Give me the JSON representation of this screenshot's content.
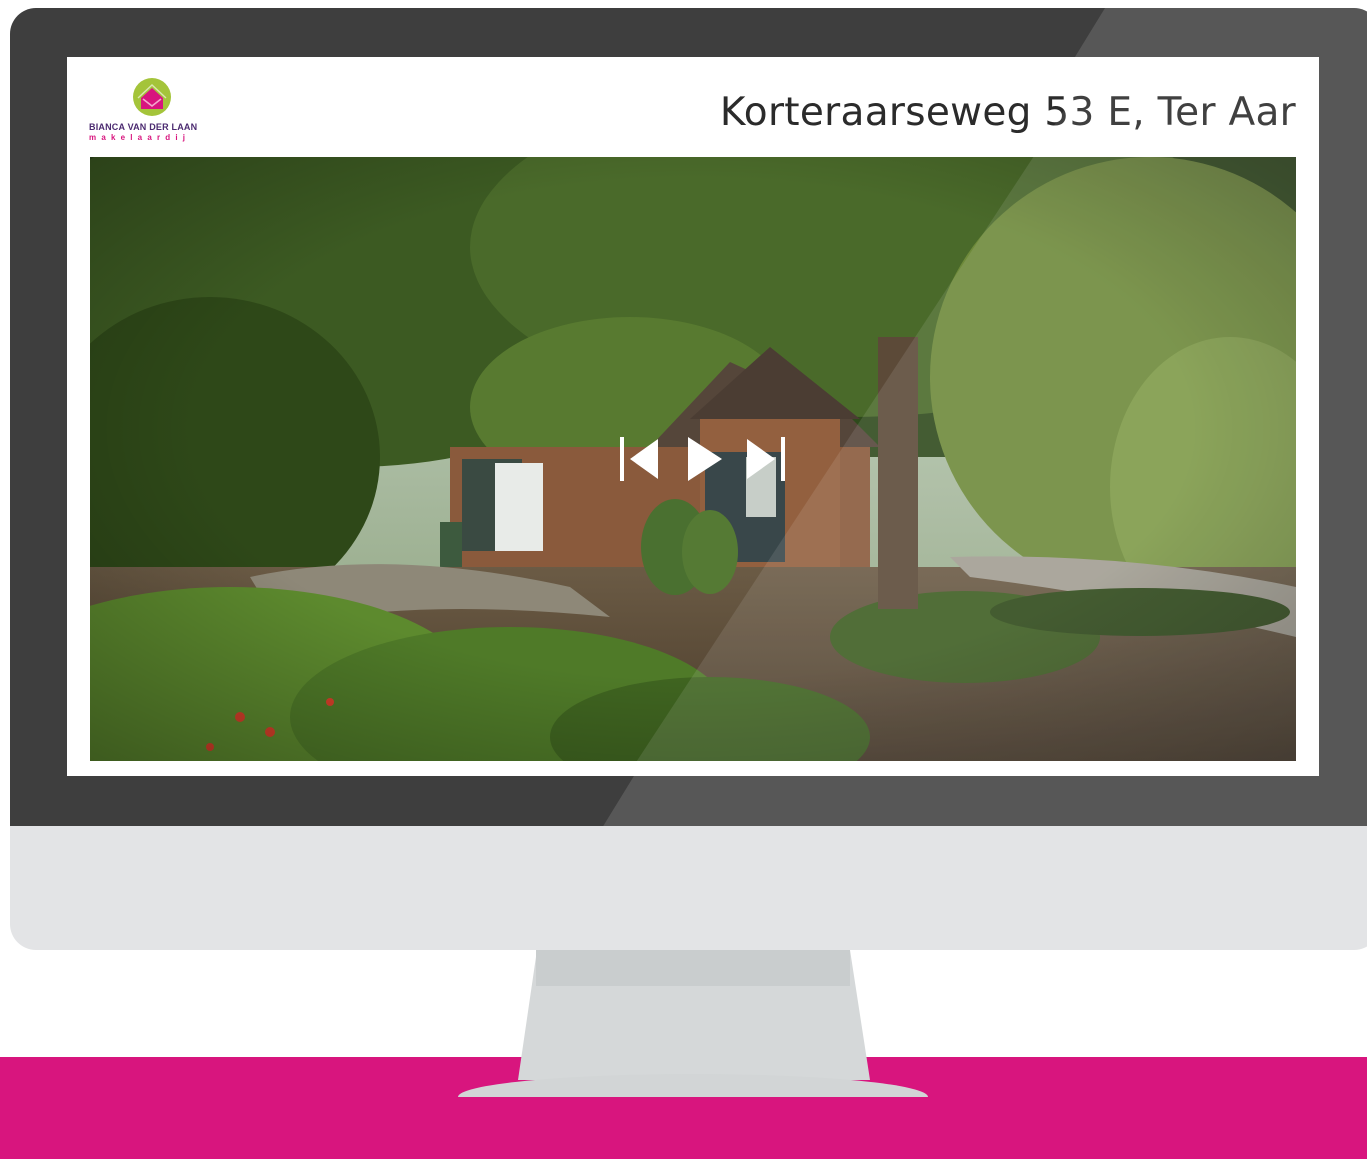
{
  "listing": {
    "title": "Korteraarseweg 53 E, Ter Aar"
  },
  "brand": {
    "name": "BIANCA VAN DER LAAN",
    "tagline": "makelaardij",
    "logo_circle_color": "#a4c43a",
    "logo_house_color": "#d8157e",
    "name_color": "#4b2a70"
  },
  "slideshow": {
    "controls": {
      "previous_icon": "skip-back-icon",
      "play_icon": "play-icon",
      "next_icon": "skip-forward-icon"
    }
  },
  "colors": {
    "accent_band": "#d8157e",
    "bezel": "#3e3e3e",
    "chin": "#e3e4e6"
  }
}
